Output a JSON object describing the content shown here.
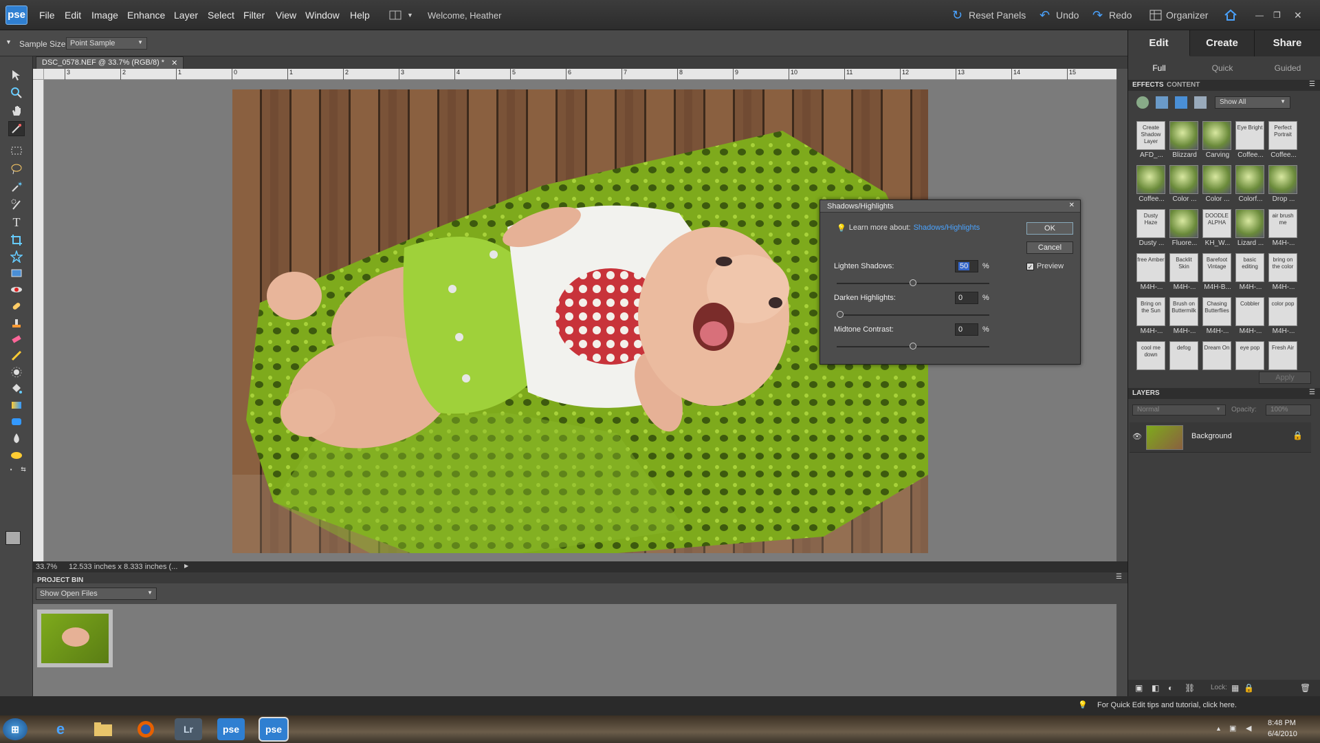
{
  "menubar": {
    "logo": "pse",
    "menus": [
      "File",
      "Edit",
      "Image",
      "Enhance",
      "Layer",
      "Select",
      "Filter",
      "View",
      "Window",
      "Help"
    ],
    "welcome": "Welcome, Heather",
    "reset_panels": "Reset Panels",
    "undo": "Undo",
    "redo": "Redo",
    "organizer": "Organizer"
  },
  "options": {
    "sample_size_label": "Sample Size:",
    "sample_size_value": "Point Sample"
  },
  "document": {
    "tab_title": "DSC_0578.NEF @ 33.7% (RGB/8) *",
    "zoom": "33.7%",
    "dimensions": "12.533 inches x 8.333 inches (...",
    "ruler_marks": [
      "3",
      "2",
      "1",
      "0",
      "1",
      "2",
      "3",
      "4",
      "5",
      "6",
      "7",
      "8",
      "9",
      "10",
      "11",
      "12",
      "13",
      "14",
      "15"
    ]
  },
  "dialog": {
    "title": "Shadows/Highlights",
    "learn_more_label": "Learn more about:",
    "learn_more_link": "Shadows/Highlights",
    "ok": "OK",
    "cancel": "Cancel",
    "preview": "Preview",
    "lighten_label": "Lighten Shadows:",
    "lighten_value": "50",
    "darken_label": "Darken Highlights:",
    "darken_value": "0",
    "midtone_label": "Midtone Contrast:",
    "midtone_value": "0",
    "pct": "%"
  },
  "panel": {
    "tabs": [
      "Edit",
      "Create",
      "Share"
    ],
    "subtabs": [
      "Full",
      "Quick",
      "Guided"
    ],
    "effects_tab": "EFFECTS",
    "content_tab": "CONTENT",
    "show_all": "Show All",
    "apply": "Apply",
    "effects": [
      {
        "thumb": "Create Shadow Layer",
        "name": "AFD_..."
      },
      {
        "thumb": "",
        "name": "Blizzard"
      },
      {
        "thumb": "",
        "name": "Carving"
      },
      {
        "thumb": "Eye Bright",
        "name": "Coffee..."
      },
      {
        "thumb": "Perfect Portrait",
        "name": "Coffee..."
      },
      {
        "thumb": "",
        "name": "Coffee..."
      },
      {
        "thumb": "",
        "name": "Color ..."
      },
      {
        "thumb": "",
        "name": "Color ..."
      },
      {
        "thumb": "",
        "name": "Colorf..."
      },
      {
        "thumb": "",
        "name": "Drop ..."
      },
      {
        "thumb": "Dusty Haze",
        "name": "Dusty ..."
      },
      {
        "thumb": "",
        "name": "Fluore..."
      },
      {
        "thumb": "DOODLE ALPHA",
        "name": "KH_W..."
      },
      {
        "thumb": "",
        "name": "Lizard ..."
      },
      {
        "thumb": "air brush me",
        "name": "M4H-..."
      },
      {
        "thumb": "free Amber",
        "name": "M4H-..."
      },
      {
        "thumb": "Backlit Skin",
        "name": "M4H-..."
      },
      {
        "thumb": "Barefoot Vintage",
        "name": "M4H-B..."
      },
      {
        "thumb": "basic editing",
        "name": "M4H-..."
      },
      {
        "thumb": "bring on the color",
        "name": "M4H-..."
      },
      {
        "thumb": "Bring on the Sun",
        "name": "M4H-..."
      },
      {
        "thumb": "Brush on Buttermilk",
        "name": "M4H-..."
      },
      {
        "thumb": "Chasing Butterflies",
        "name": "M4H-..."
      },
      {
        "thumb": "Cobbler",
        "name": "M4H-..."
      },
      {
        "thumb": "color pop",
        "name": "M4H-..."
      },
      {
        "thumb": "cool me down",
        "name": ""
      },
      {
        "thumb": "defog",
        "name": ""
      },
      {
        "thumb": "Dream On",
        "name": ""
      },
      {
        "thumb": "eye pop",
        "name": ""
      },
      {
        "thumb": "Fresh Air",
        "name": ""
      }
    ],
    "layers_header": "LAYERS",
    "blend_mode": "Normal",
    "opacity_label": "Opacity:",
    "opacity_value": "100%",
    "layer_name": "Background",
    "lock_label": "Lock:"
  },
  "project_bin": {
    "header": "PROJECT BIN",
    "show": "Show Open Files"
  },
  "tip": "For Quick Edit tips and tutorial, click here.",
  "taskbar": {
    "time": "8:48 PM",
    "date": "6/4/2010",
    "apps": [
      "Lr",
      "pse",
      "pse"
    ]
  }
}
